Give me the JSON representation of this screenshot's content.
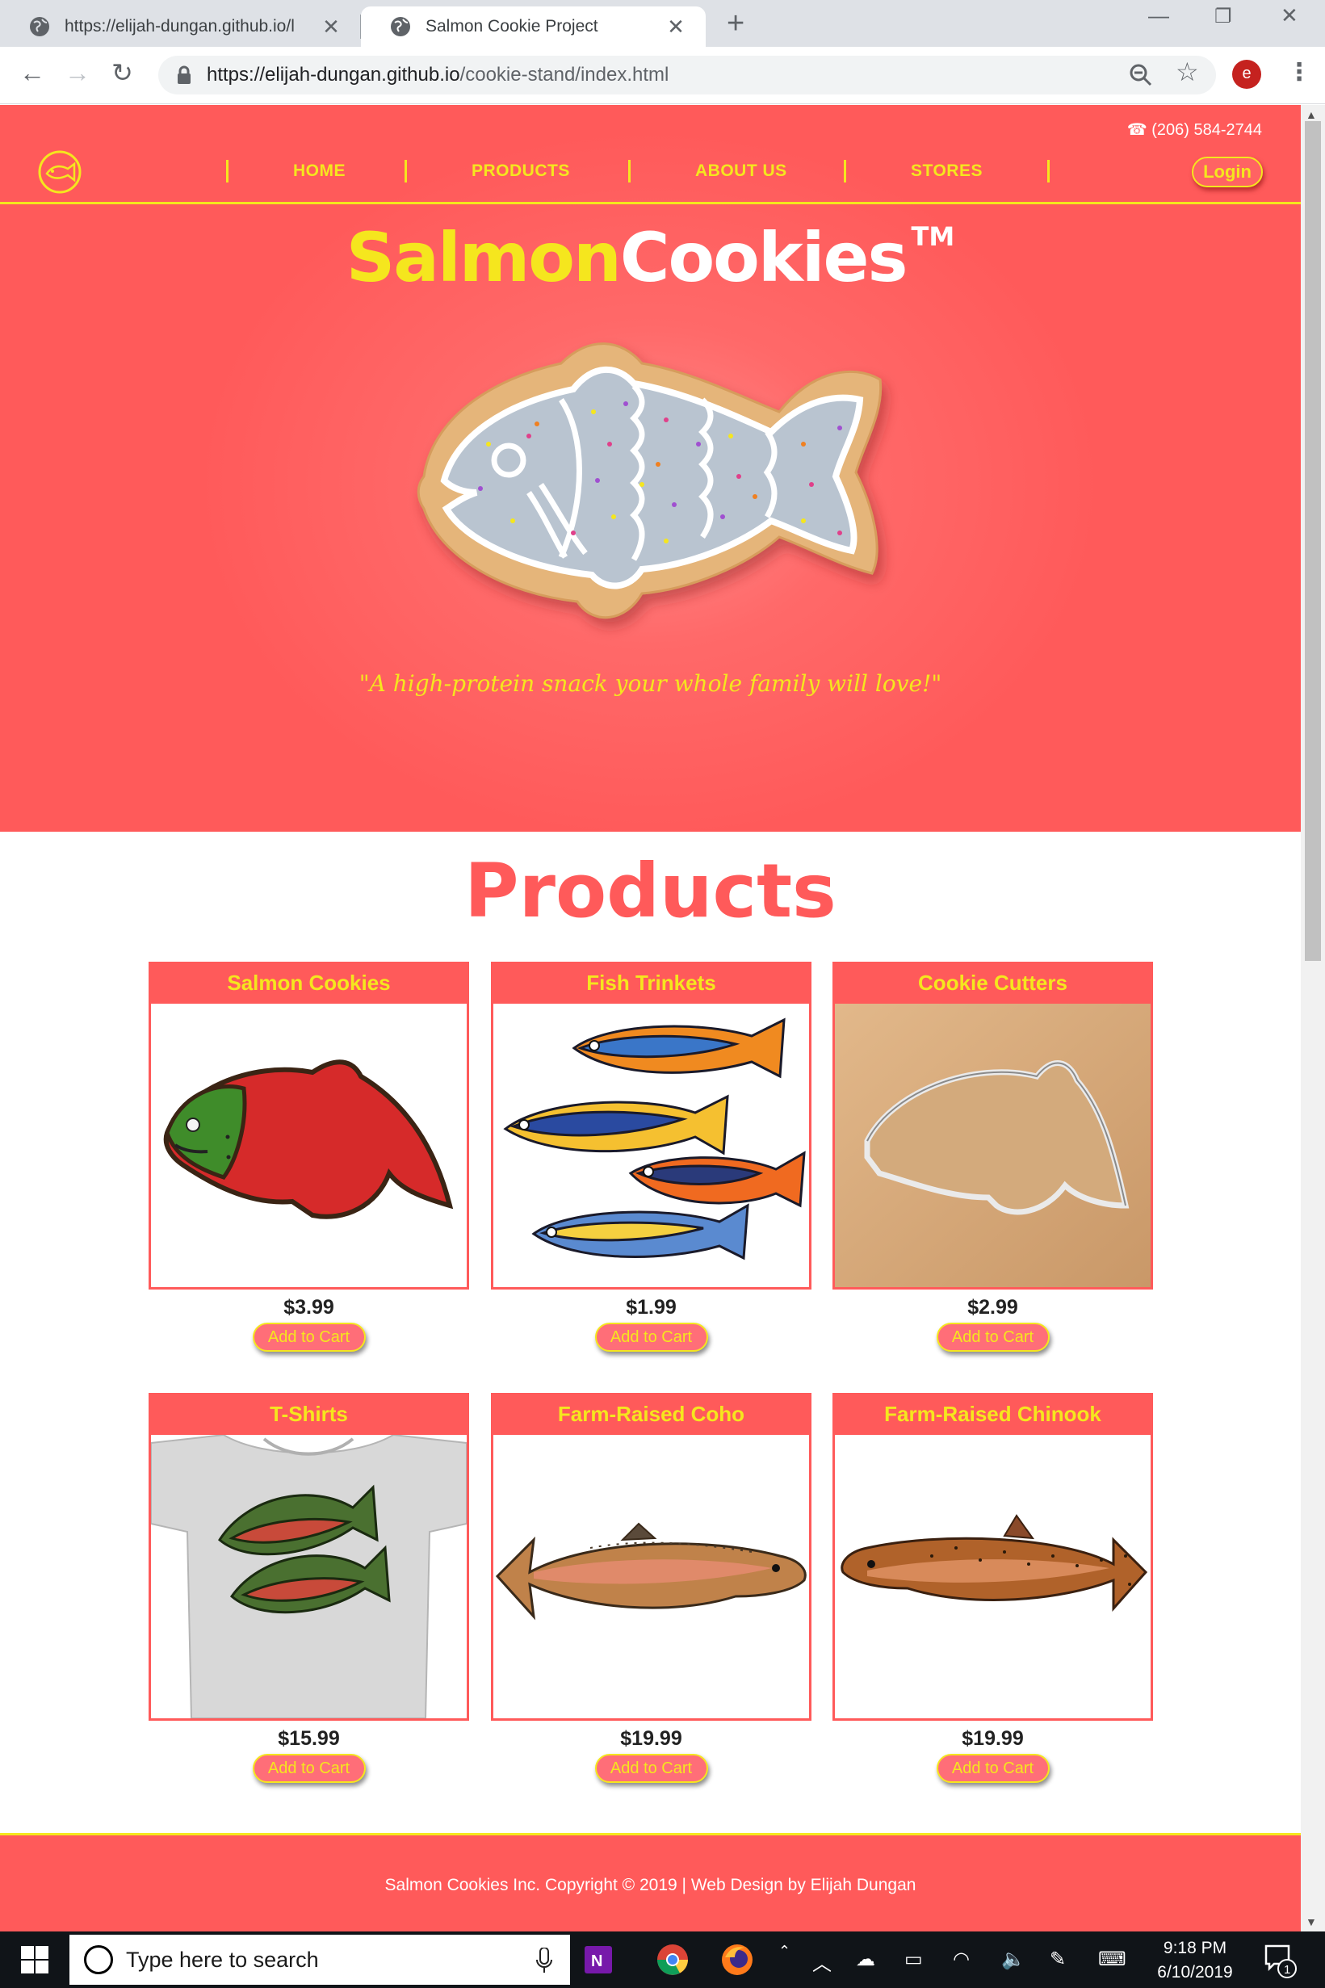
{
  "browser": {
    "tabs": [
      {
        "title": "https://elijah-dungan.github.io/l",
        "active": false
      },
      {
        "title": "Salmon Cookie Project",
        "active": true
      }
    ],
    "url_host": "https://elijah-dungan.github.io",
    "url_path": "/cookie-stand/index.html",
    "profile_initial": "e"
  },
  "site": {
    "phone": "☎ (206) 584-2744",
    "nav": [
      "HOME",
      "PRODUCTS",
      "ABOUT US",
      "STORES"
    ],
    "login": "Login",
    "brand_part1": "Salmon",
    "brand_part2": "Cookies",
    "brand_tm": "TM",
    "tagline": "\"A high-protein snack your whole family will love!\"",
    "products_title": "Products",
    "add_to_cart": "Add to Cart",
    "products": [
      {
        "name": "Salmon Cookies",
        "price": "$3.99"
      },
      {
        "name": "Fish Trinkets",
        "price": "$1.99"
      },
      {
        "name": "Cookie Cutters",
        "price": "$2.99"
      },
      {
        "name": "T-Shirts",
        "price": "$15.99"
      },
      {
        "name": "Farm-Raised Coho",
        "price": "$19.99"
      },
      {
        "name": "Farm-Raised Chinook",
        "price": "$19.99"
      }
    ],
    "footer": "Salmon Cookies Inc. Copyright © 2019 | Web Design by Elijah Dungan",
    "colors": {
      "brand_red": "#ff5a5a",
      "brand_yellow": "#f5e61e"
    }
  },
  "taskbar": {
    "search_placeholder": "Type here to search",
    "time": "9:18 PM",
    "date": "6/10/2019",
    "notification_count": "1"
  }
}
